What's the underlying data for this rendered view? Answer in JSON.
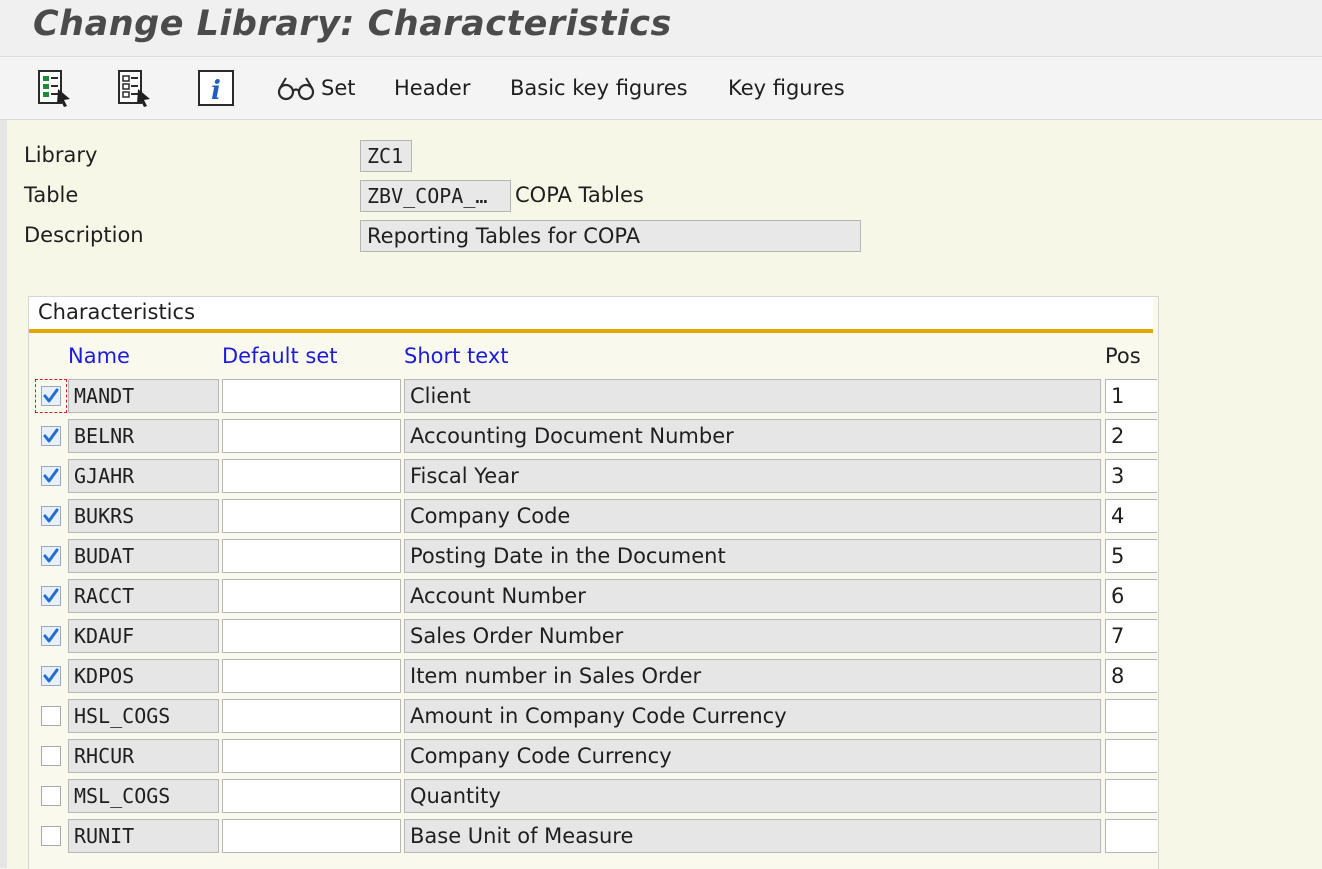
{
  "window": {
    "title": "Change Library: Characteristics"
  },
  "toolbar": {
    "icons": [
      "select-all-icon",
      "deselect-all-icon",
      "info-icon",
      "glasses-icon"
    ],
    "set_label": "Set",
    "header_label": "Header",
    "basic_key_figures_label": "Basic key figures",
    "key_figures_label": "Key figures"
  },
  "form": {
    "library_label": "Library",
    "library_value": "ZC1",
    "table_label": "Table",
    "table_value": "ZBV_COPA_…",
    "table_desc": "COPA Tables",
    "description_label": "Description",
    "description_value": "Reporting Tables for COPA"
  },
  "characteristics": {
    "section_title": "Characteristics",
    "columns": {
      "name": "Name",
      "default_set": "Default set",
      "short_text": "Short text",
      "pos": "Pos"
    },
    "rows": [
      {
        "checked": true,
        "name": "MANDT",
        "default_set": "",
        "short_text": "Client",
        "pos": "1"
      },
      {
        "checked": true,
        "name": "BELNR",
        "default_set": "",
        "short_text": "Accounting Document Number",
        "pos": "2"
      },
      {
        "checked": true,
        "name": "GJAHR",
        "default_set": "",
        "short_text": "Fiscal Year",
        "pos": "3"
      },
      {
        "checked": true,
        "name": "BUKRS",
        "default_set": "",
        "short_text": "Company Code",
        "pos": "4"
      },
      {
        "checked": true,
        "name": "BUDAT",
        "default_set": "",
        "short_text": "Posting Date in the Document",
        "pos": "5"
      },
      {
        "checked": true,
        "name": "RACCT",
        "default_set": "",
        "short_text": "Account Number",
        "pos": "6"
      },
      {
        "checked": true,
        "name": "KDAUF",
        "default_set": "",
        "short_text": "Sales Order Number",
        "pos": "7"
      },
      {
        "checked": true,
        "name": "KDPOS",
        "default_set": "",
        "short_text": "Item number in Sales Order",
        "pos": "8"
      },
      {
        "checked": false,
        "name": "HSL_COGS",
        "default_set": "",
        "short_text": "Amount in Company Code Currency",
        "pos": ""
      },
      {
        "checked": false,
        "name": "RHCUR",
        "default_set": "",
        "short_text": "Company Code Currency",
        "pos": ""
      },
      {
        "checked": false,
        "name": "MSL_COGS",
        "default_set": "",
        "short_text": "Quantity",
        "pos": ""
      },
      {
        "checked": false,
        "name": "RUNIT",
        "default_set": "",
        "short_text": "Base Unit of Measure",
        "pos": ""
      }
    ]
  },
  "colors": {
    "accent": "#e5a800",
    "header_link": "#1d1dd9",
    "checkmark": "#1e6fd0",
    "focus": "#d02020"
  }
}
